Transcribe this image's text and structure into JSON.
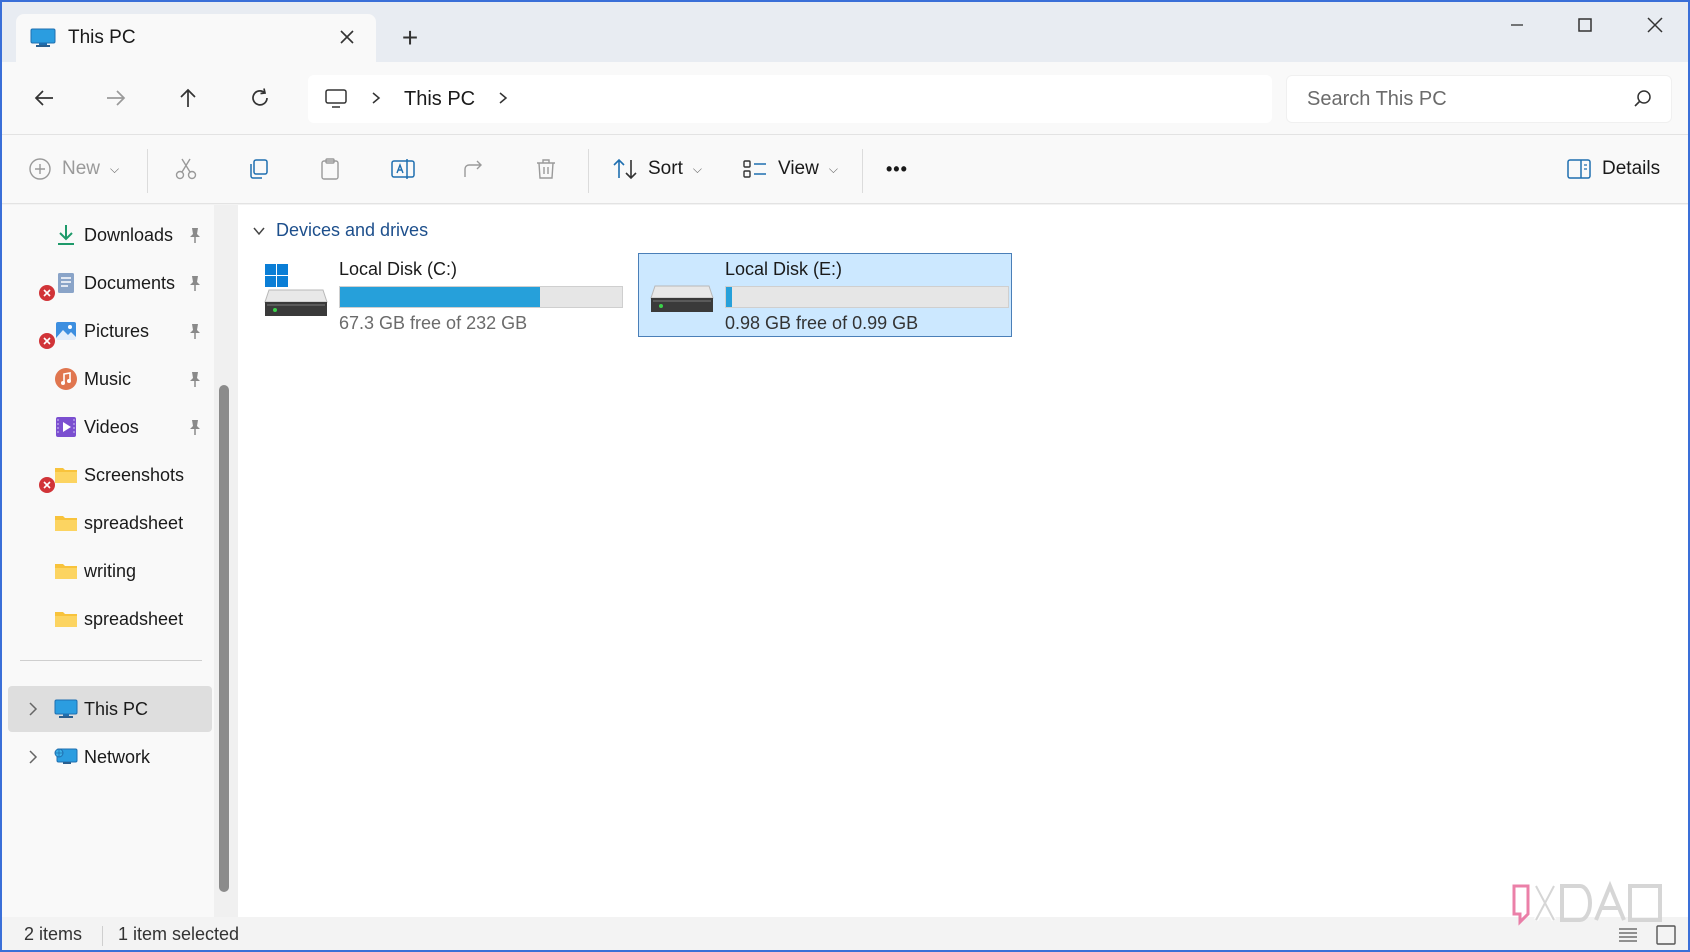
{
  "window": {
    "tab_title": "This PC",
    "new_tab_label": "+"
  },
  "nav": {
    "breadcrumb": [
      "This PC"
    ],
    "search_placeholder": "Search This PC"
  },
  "commands": {
    "new_label": "New",
    "sort_label": "Sort",
    "view_label": "View",
    "more_label": "•••",
    "details_label": "Details"
  },
  "sidebar": {
    "quick_access": [
      {
        "label": "Downloads",
        "icon": "download-icon",
        "pinned": true,
        "error": false
      },
      {
        "label": "Documents",
        "icon": "documents-icon",
        "pinned": true,
        "error": true
      },
      {
        "label": "Pictures",
        "icon": "pictures-icon",
        "pinned": true,
        "error": true
      },
      {
        "label": "Music",
        "icon": "music-icon",
        "pinned": true,
        "error": false
      },
      {
        "label": "Videos",
        "icon": "videos-icon",
        "pinned": true,
        "error": false
      },
      {
        "label": "Screenshots",
        "icon": "folder-icon",
        "pinned": false,
        "error": true
      },
      {
        "label": "spreadsheet",
        "icon": "folder-icon",
        "pinned": false,
        "error": false
      },
      {
        "label": "writing",
        "icon": "folder-icon",
        "pinned": false,
        "error": false
      },
      {
        "label": "spreadsheet",
        "icon": "folder-icon",
        "pinned": false,
        "error": false
      }
    ],
    "locations": [
      {
        "label": "This PC",
        "icon": "this-pc-icon",
        "selected": true
      },
      {
        "label": "Network",
        "icon": "network-icon",
        "selected": false
      }
    ]
  },
  "content": {
    "group_title": "Devices and drives",
    "drives": [
      {
        "name": "Local Disk (C:)",
        "free_text": "67.3 GB free of 232 GB",
        "used_fraction": 0.71,
        "selected": false,
        "windows_logo": true
      },
      {
        "name": "Local Disk (E:)",
        "free_text": "0.98 GB free of 0.99 GB",
        "used_fraction": 0.02,
        "selected": true,
        "windows_logo": false
      }
    ]
  },
  "status": {
    "item_count": "2 items",
    "selection": "1 item selected"
  },
  "colors": {
    "accent": "#26a0da",
    "selection": "#cce8ff",
    "error": "#d13438",
    "folder": "#f8c33c"
  }
}
